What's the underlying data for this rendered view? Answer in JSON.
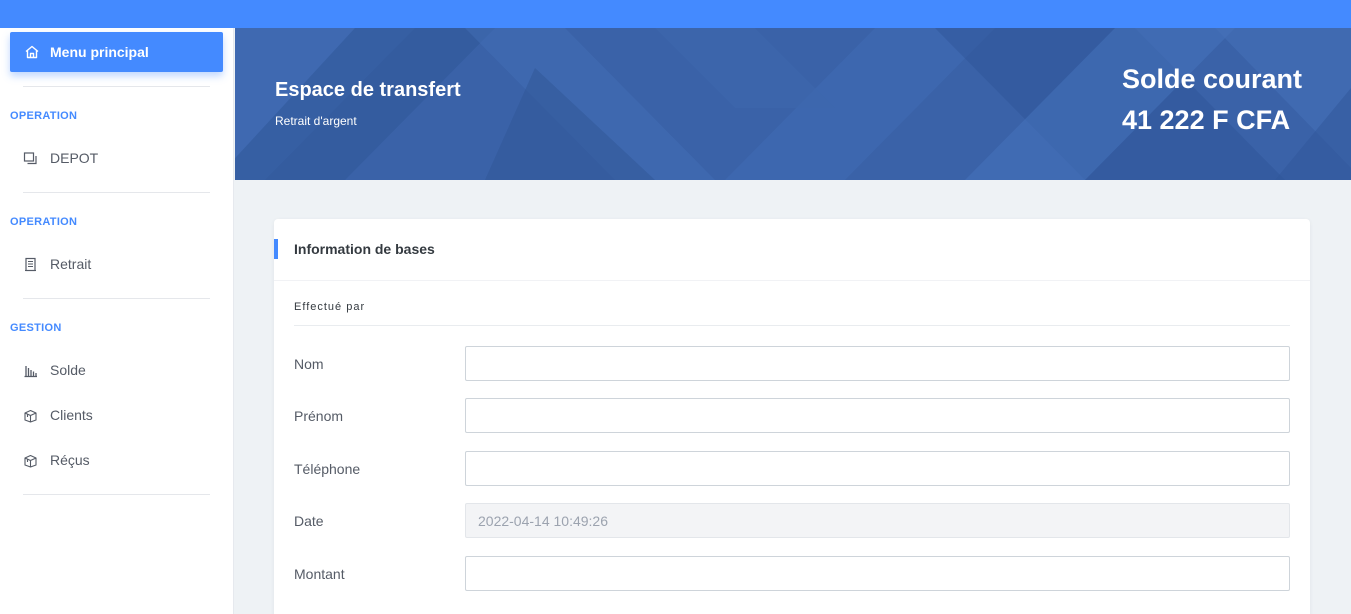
{
  "sidebar": {
    "main_menu_label": "Menu principal",
    "sections": [
      {
        "title": "OPERATION",
        "items": [
          {
            "label": "DEPOT",
            "icon": "copy-icon"
          }
        ]
      },
      {
        "title": "OPERATION",
        "items": [
          {
            "label": "Retrait",
            "icon": "document-icon"
          }
        ]
      },
      {
        "title": "GESTION",
        "items": [
          {
            "label": "Solde",
            "icon": "bar-chart-icon"
          },
          {
            "label": "Clients",
            "icon": "box-icon"
          },
          {
            "label": "Réçus",
            "icon": "box-icon"
          }
        ]
      }
    ]
  },
  "banner": {
    "title": "Espace de transfert",
    "subtitle": "Retrait d'argent",
    "balance_label": "Solde courant",
    "balance_value": "41 222 F CFA"
  },
  "form": {
    "card_title": "Information de bases",
    "section_label": "Effectué par",
    "fields": [
      {
        "label": "Nom",
        "value": "",
        "disabled": false
      },
      {
        "label": "Prénom",
        "value": "",
        "disabled": false
      },
      {
        "label": "Téléphone",
        "value": "",
        "disabled": false
      },
      {
        "label": "Date",
        "value": "2022-04-14 10:49:26",
        "disabled": true
      },
      {
        "label": "Montant",
        "value": "",
        "disabled": false
      }
    ]
  },
  "colors": {
    "accent": "#448aff",
    "banner": "#3a62a8",
    "background": "#eef2f5"
  }
}
